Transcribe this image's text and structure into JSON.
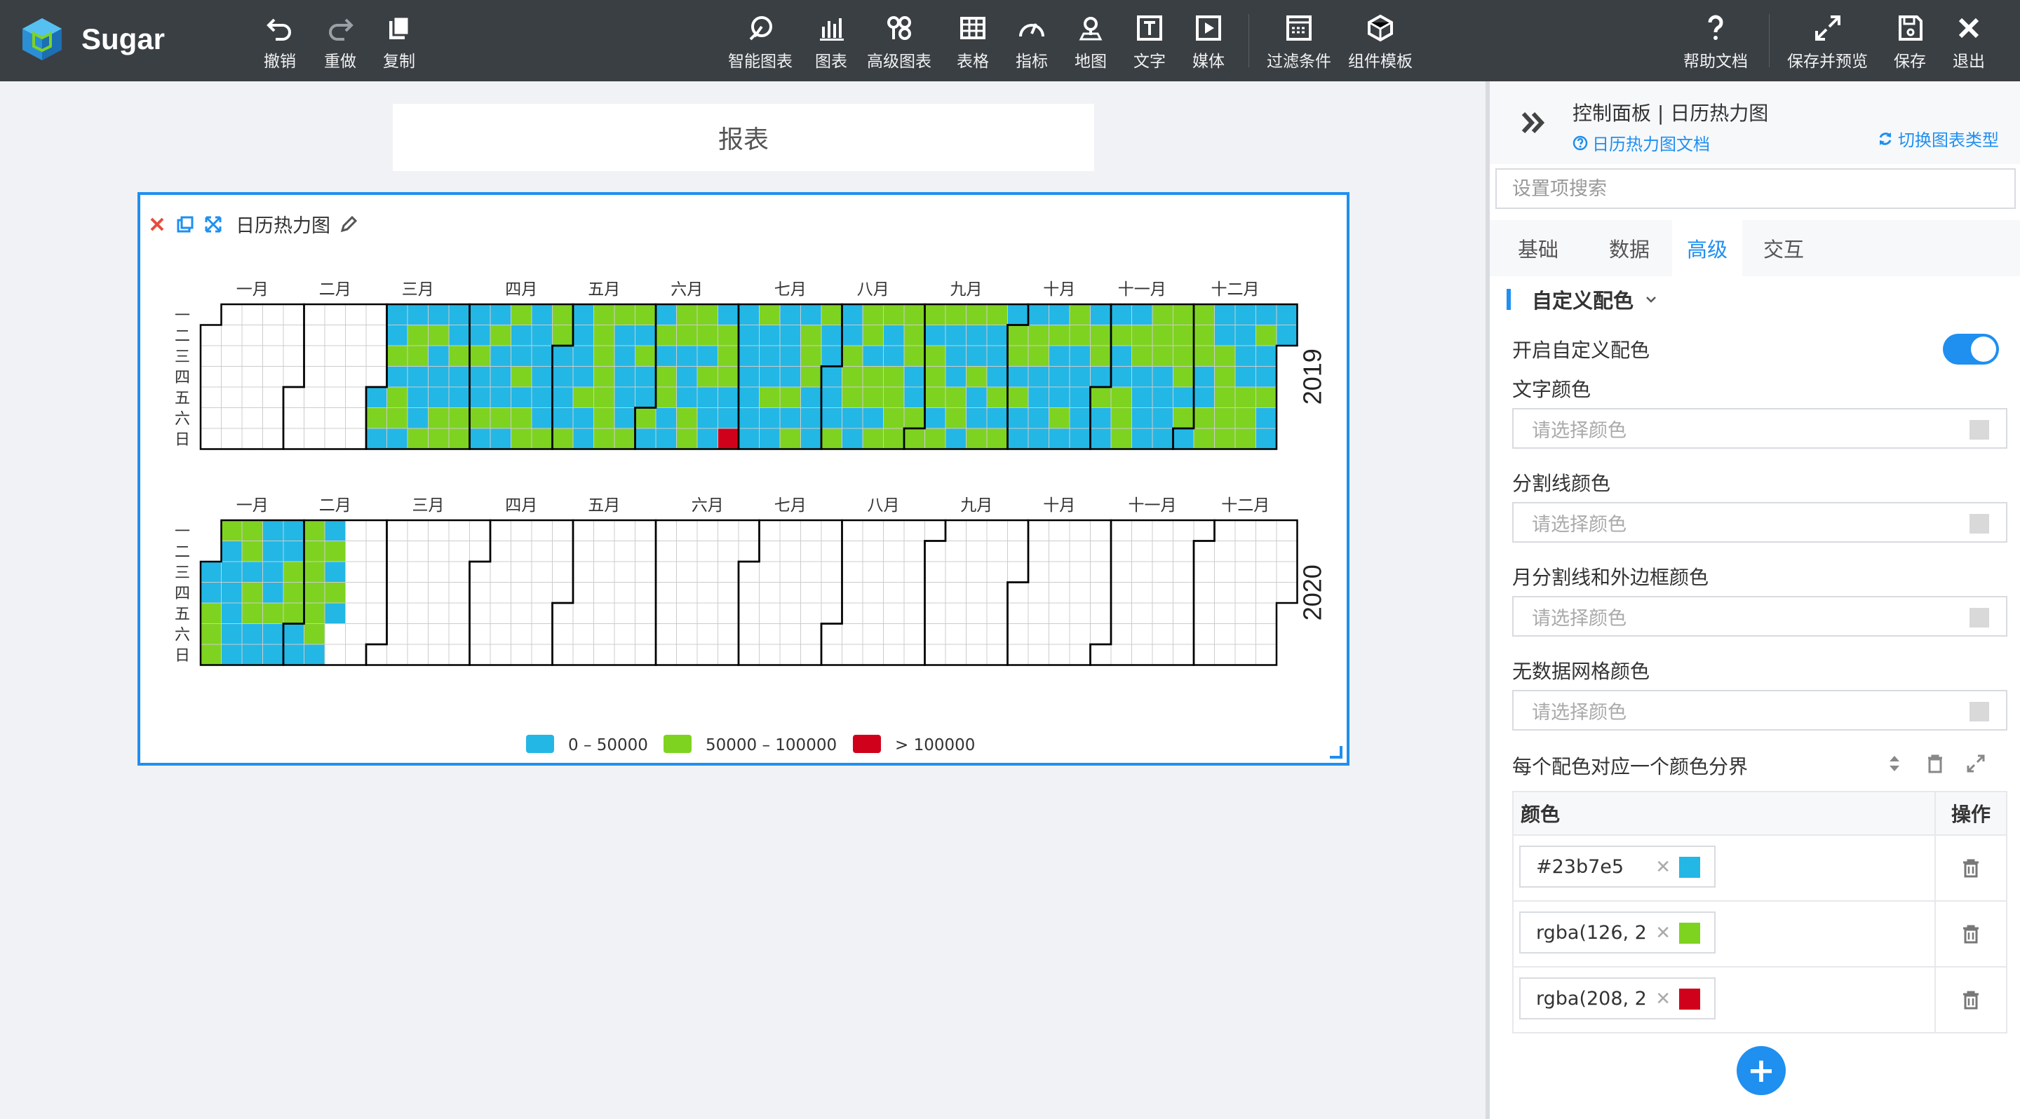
{
  "app": {
    "name": "Sugar"
  },
  "toolbar": {
    "left": [
      {
        "label": "撤销",
        "icon": "undo-icon"
      },
      {
        "label": "重做",
        "icon": "redo-icon"
      },
      {
        "label": "复制",
        "icon": "copy-icon"
      }
    ],
    "center": [
      {
        "label": "智能图表",
        "icon": "smart-chart-icon"
      },
      {
        "label": "图表",
        "icon": "bar-chart-icon"
      },
      {
        "label": "高级图表",
        "icon": "advanced-chart-icon"
      },
      {
        "label": "表格",
        "icon": "table-icon"
      },
      {
        "label": "指标",
        "icon": "gauge-icon"
      },
      {
        "label": "地图",
        "icon": "map-pin-icon"
      },
      {
        "label": "文字",
        "icon": "text-icon"
      },
      {
        "label": "媒体",
        "icon": "media-icon"
      },
      {
        "label": "过滤条件",
        "icon": "filter-icon"
      },
      {
        "label": "组件模板",
        "icon": "template-icon"
      }
    ],
    "right": [
      {
        "label": "帮助文档",
        "icon": "help-icon"
      },
      {
        "label": "保存并预览",
        "icon": "expand-icon"
      },
      {
        "label": "保存",
        "icon": "save-icon"
      },
      {
        "label": "退出",
        "icon": "close-icon"
      }
    ]
  },
  "report": {
    "title": "报表"
  },
  "chart_widget": {
    "name": "日历热力图"
  },
  "chart_data": {
    "type": "heatmap",
    "subtype": "calendar",
    "years": [
      "2019",
      "2020"
    ],
    "months": [
      "一月",
      "二月",
      "三月",
      "四月",
      "五月",
      "六月",
      "七月",
      "八月",
      "九月",
      "十月",
      "十一月",
      "十二月"
    ],
    "weekdays": [
      "一",
      "二",
      "三",
      "四",
      "五",
      "六",
      "日"
    ],
    "visual_map": [
      {
        "label": "0 – 50000",
        "color": "#23b7e5",
        "min": 0,
        "max": 50000
      },
      {
        "label": "50000 – 100000",
        "color": "#7ed321",
        "min": 50000,
        "max": 100000
      },
      {
        "label": "> 100000",
        "color": "#d0021b",
        "min": 100000
      }
    ],
    "data_range_2019": [
      "2019-03-01",
      "2019-12-31"
    ],
    "data_range_2020": [
      "2020-01-01",
      "2020-02-14"
    ],
    "peak_date": "2019-06-30"
  },
  "panel": {
    "title": "控制面板 | 日历热力图",
    "doc_link": "日历热力图文档",
    "switch_link": "切换图表类型",
    "search_placeholder": "设置项搜索",
    "tabs": [
      "基础",
      "数据",
      "高级",
      "交互"
    ],
    "active_tab": "高级",
    "section": "自定义配色",
    "enable_label": "开启自定义配色",
    "fields": [
      {
        "label": "文字颜色",
        "placeholder": "请选择颜色"
      },
      {
        "label": "分割线颜色",
        "placeholder": "请选择颜色"
      },
      {
        "label": "月分割线和外边框颜色",
        "placeholder": "请选择颜色"
      },
      {
        "label": "无数据网格颜色",
        "placeholder": "请选择颜色"
      }
    ],
    "mapping_label": "每个配色对应一个颜色分界",
    "table_headers": {
      "color": "颜色",
      "action": "操作"
    },
    "colors": [
      {
        "value": "#23b7e5",
        "swatch": "#23b7e5"
      },
      {
        "value": "rgba(126, 2",
        "swatch": "#7ed321"
      },
      {
        "value": "rgba(208, 2",
        "swatch": "#d0021b"
      }
    ],
    "add_label": "+"
  }
}
